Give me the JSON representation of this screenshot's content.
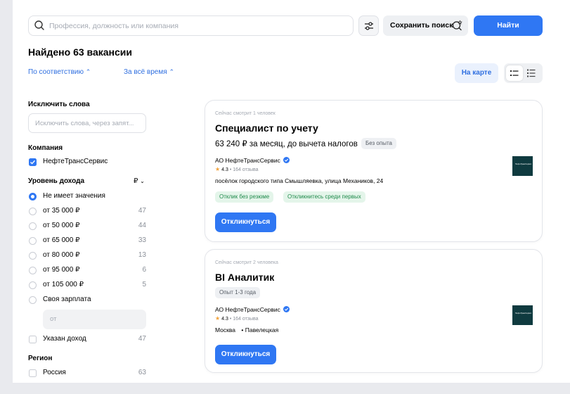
{
  "search": {
    "placeholder": "Профессия, должность или компания"
  },
  "toolbar": {
    "save_label": "Сохранить поиск",
    "find_label": "Найти"
  },
  "results": {
    "title": "Найдено 63 вакансии"
  },
  "sort": {
    "relevance": "По соответствию",
    "period": "За всё время"
  },
  "view": {
    "map_label": "На карте"
  },
  "filters": {
    "exclude": {
      "label": "Исключить слова",
      "placeholder": "Исключить слова, через запят..."
    },
    "company": {
      "label": "Компания",
      "item": "НефтеТрансСервис",
      "checked": true
    },
    "income": {
      "label": "Уровень дохода",
      "currency": "₽",
      "options": [
        {
          "label": "Не имеет значения",
          "count": "",
          "selected": true
        },
        {
          "label": "от 35 000 ₽",
          "count": "47"
        },
        {
          "label": "от 50 000 ₽",
          "count": "44"
        },
        {
          "label": "от 65 000 ₽",
          "count": "33"
        },
        {
          "label": "от 80 000 ₽",
          "count": "13"
        },
        {
          "label": "от 95 000 ₽",
          "count": "6"
        },
        {
          "label": "от 105 000 ₽",
          "count": "5"
        },
        {
          "label": "Своя зарплата",
          "count": ""
        }
      ],
      "custom_placeholder": "от",
      "specified": {
        "label": "Указан доход",
        "count": "47"
      }
    },
    "region": {
      "label": "Регион",
      "item": "Россия",
      "count": "63"
    }
  },
  "vacancies": [
    {
      "watching": "Сейчас смотрит 1 человек",
      "title": "Специалист по учету",
      "salary": "63 240 ₽ за месяц, до вычета налогов",
      "experience": "Без опыта",
      "company": "АО НефтеТрансСервис",
      "rating": "4.3",
      "reviews": "164 отзыва",
      "address": "посёлок городского типа Смышляевка, улица Механиков, 24",
      "tags": [
        "Отклик без резюме",
        "Откликнитесь среди первых"
      ],
      "logo_text": "НефтеТрансСервис",
      "apply": "Откликнуться"
    },
    {
      "watching": "Сейчас смотрит 2 человека",
      "title": "BI Аналитик",
      "experience": "Опыт 1-3 года",
      "company": "АО НефтеТрансСервис",
      "rating": "4.3",
      "reviews": "164 отзыва",
      "address": "Москва",
      "metro": "Павелецкая",
      "logo_text": "НефтеТрансСервис",
      "apply": "Откликнуться"
    }
  ],
  "colors": {
    "accent": "#2f77f3",
    "green_tag": "#e4f5ea",
    "logo_bg": "#0f3a3f"
  }
}
